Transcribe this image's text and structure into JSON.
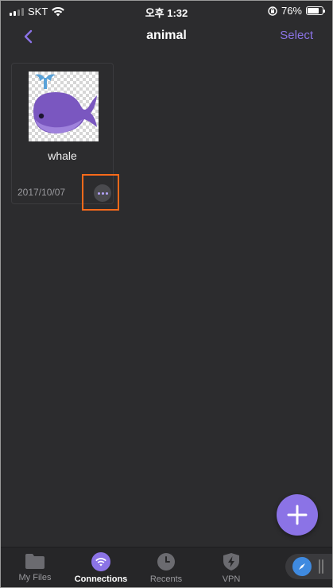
{
  "status": {
    "carrier": "SKT",
    "time": "오후 1:32",
    "battery": "76%",
    "battery_level": 0.76
  },
  "header": {
    "title": "animal",
    "select_label": "Select",
    "back_icon": "chevron-left-icon"
  },
  "files": [
    {
      "name": "whale",
      "date": "2017/10/07",
      "thumbnail": "whale-icon",
      "more_icon": "more-icon"
    }
  ],
  "fab": {
    "icon": "plus-icon"
  },
  "tabs": [
    {
      "label": "My Files",
      "icon": "folder-icon",
      "active": false
    },
    {
      "label": "Connections",
      "icon": "wifi-icon",
      "active": true
    },
    {
      "label": "Recents",
      "icon": "clock-icon",
      "active": false
    },
    {
      "label": "VPN",
      "icon": "shield-bolt-icon",
      "active": false
    }
  ],
  "colors": {
    "accent": "#8b73e6",
    "background": "#2c2c2e",
    "highlight": "#ff6a1a"
  }
}
